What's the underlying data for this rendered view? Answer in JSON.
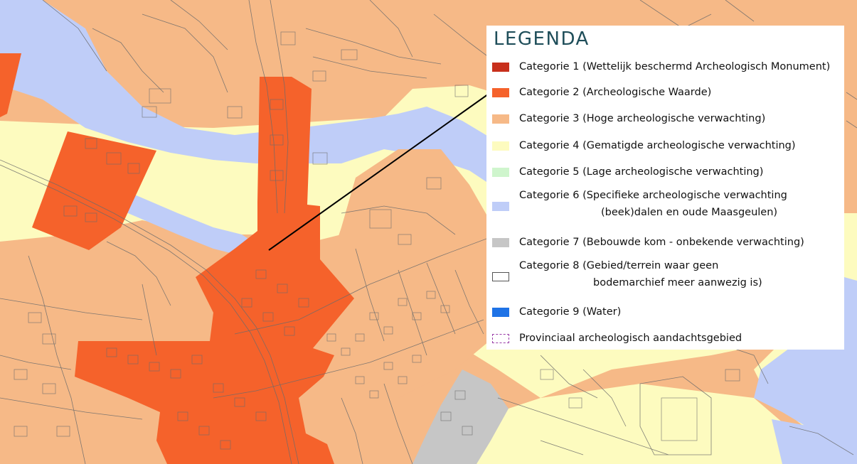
{
  "legend": {
    "title": "LEGENDA",
    "items": [
      {
        "number": "1",
        "prefix": "Categorie",
        "desc": "(Wettelijk beschermd Archeologisch Monument)",
        "desc2": "",
        "color": "#c8301c",
        "style": "fill"
      },
      {
        "number": "2",
        "prefix": "Categorie",
        "desc": "(Archeologische Waarde)",
        "desc2": "",
        "color": "#f5622b",
        "style": "fill"
      },
      {
        "number": "3",
        "prefix": "Categorie",
        "desc": "(Hoge archeologische verwachting)",
        "desc2": "",
        "color": "#f6b987",
        "style": "fill"
      },
      {
        "number": "4",
        "prefix": "Categorie",
        "desc": "(Gematigde archeologische verwachting)",
        "desc2": "",
        "color": "#fdfbbf",
        "style": "fill"
      },
      {
        "number": "5",
        "prefix": "Categorie",
        "desc": "(Lage archeologische verwachting)",
        "desc2": "",
        "color": "#cff5cd",
        "style": "fill"
      },
      {
        "number": "6",
        "prefix": "Categorie",
        "desc": "(Specifieke archeologische verwachting",
        "desc2": "(beek)dalen en oude Maasgeulen)",
        "color": "#bfcdf8",
        "style": "fill"
      },
      {
        "number": "7",
        "prefix": "Categorie",
        "desc": "(Bebouwde kom - onbekende verwachting)",
        "desc2": "",
        "color": "#c6c6c6",
        "style": "fill"
      },
      {
        "number": "8",
        "prefix": "Categorie",
        "desc": "(Gebied/terrein waar geen",
        "desc2": "bodemarchief meer aanwezig is)",
        "color": "#ffffff",
        "style": "outline"
      },
      {
        "number": "9",
        "prefix": "Categorie",
        "desc": "(Water)",
        "desc2": "",
        "color": "#1f73e6",
        "style": "fill"
      },
      {
        "number": "",
        "prefix": "Provinciaal archeologisch aandachtsgebied",
        "desc": "",
        "desc2": "",
        "color": "#9b3fa8",
        "style": "dashed"
      }
    ]
  },
  "map_colors": {
    "high_expectation": "#f6b987",
    "archaeological_value": "#f5622b",
    "moderate_expectation": "#fdfbbf",
    "stream_valley": "#bfcdf8",
    "built_up_area": "#c6c6c6",
    "parcel_lines": "#6b6b6b"
  }
}
